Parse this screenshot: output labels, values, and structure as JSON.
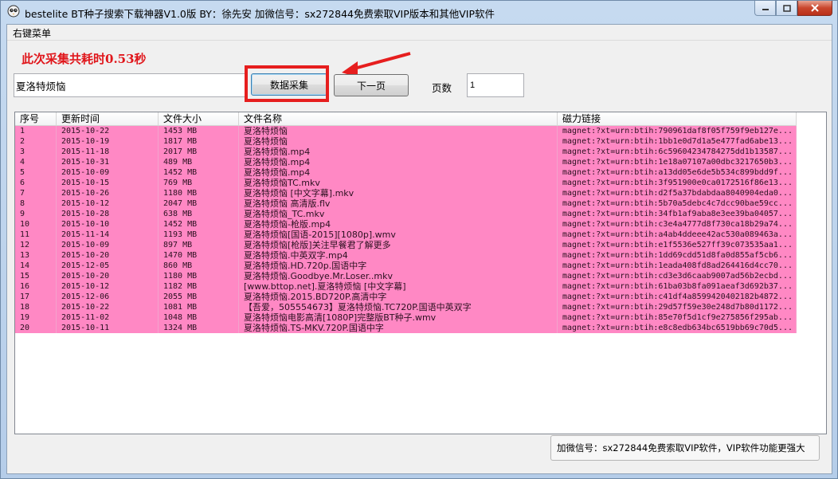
{
  "window": {
    "title": "bestelite BT种子搜索下载神器V1.0版  BY：徐先安   加微信号：sx272844免费索取VIP版本和其他VIP软件"
  },
  "menu": {
    "right_click_menu": "右键菜单"
  },
  "status_text": "此次采集共耗时0.53秒",
  "search": {
    "value": "夏洛特烦恼"
  },
  "buttons": {
    "collect": "数据采集",
    "next_page": "下一页"
  },
  "page": {
    "label": "页数",
    "value": "1"
  },
  "table": {
    "headers": [
      "序号",
      "更新时间",
      "文件大小",
      "文件名称",
      "磁力链接"
    ],
    "rows": [
      [
        "1",
        "2015-10-22",
        "1453 MB",
        "夏洛特烦恼",
        "magnet:?xt=urn:btih:790961daf8f05f759f9eb127e..."
      ],
      [
        "2",
        "2015-10-19",
        "1817 MB",
        "夏洛特烦恼",
        "magnet:?xt=urn:btih:1bb1e0d7d1a5e477fad6abe13..."
      ],
      [
        "3",
        "2015-11-18",
        "2017 MB",
        "夏洛特烦恼.mp4",
        "magnet:?xt=urn:btih:6c59604234784275dd1b13587..."
      ],
      [
        "4",
        "2015-10-31",
        "489 MB",
        "夏洛特烦恼.mp4",
        "magnet:?xt=urn:btih:1e18a07107a00dbc3217650b3..."
      ],
      [
        "5",
        "2015-10-09",
        "1452 MB",
        "夏洛特烦恼.mp4",
        "magnet:?xt=urn:btih:a13dd05e6de5b534c899bdd9f..."
      ],
      [
        "6",
        "2015-10-15",
        "769 MB",
        "夏洛特烦恼TC.mkv",
        "magnet:?xt=urn:btih:3f951900e0ca0172516f86e13..."
      ],
      [
        "7",
        "2015-10-26",
        "1180 MB",
        "夏洛特烦恼 [中文字幕].mkv",
        "magnet:?xt=urn:btih:d2f5a37bdabdaa8040904eda0..."
      ],
      [
        "8",
        "2015-10-12",
        "2047 MB",
        "夏洛特烦恼 高清版.flv",
        "magnet:?xt=urn:btih:5b70a5debc4c7dcc90bae59cc..."
      ],
      [
        "9",
        "2015-10-28",
        "638 MB",
        "夏洛特烦恼_TC.mkv",
        "magnet:?xt=urn:btih:34fb1af9aba8e3ee39ba04057..."
      ],
      [
        "10",
        "2015-10-10",
        "1452 MB",
        "夏洛特烦恼-枪版.mp4",
        "magnet:?xt=urn:btih:c3e4a4777d8f730ca18b29a74..."
      ],
      [
        "11",
        "2015-11-14",
        "1193 MB",
        "夏洛特烦恼[国语-2015][1080p].wmv",
        "magnet:?xt=urn:btih:a4ab4ddeee42ac530a089463a..."
      ],
      [
        "12",
        "2015-10-09",
        "897 MB",
        "夏洛特烦恼[枪版]关注早餐君了解更多",
        "magnet:?xt=urn:btih:e1f5536e527ff39c073535aa1..."
      ],
      [
        "13",
        "2015-10-20",
        "1470 MB",
        "夏洛特烦恼.中英双字.mp4",
        "magnet:?xt=urn:btih:1dd69cdd51d8fa0d855af5cb6..."
      ],
      [
        "14",
        "2015-12-05",
        "860 MB",
        "夏洛特烦恼.HD.720p.国语中字",
        "magnet:?xt=urn:btih:1eada408fd8ad264416d4cc70..."
      ],
      [
        "15",
        "2015-10-20",
        "1180 MB",
        "夏洛特烦恼.Goodbye.Mr.Loser..mkv",
        "magnet:?xt=urn:btih:cd3e3d6caab9007ad56b2ecbd..."
      ],
      [
        "16",
        "2015-10-12",
        "1182 MB",
        "[www.bttop.net].夏洛特烦恼 [中文字幕]",
        "magnet:?xt=urn:btih:61ba03b8fa091aeaf3d692b37..."
      ],
      [
        "17",
        "2015-12-06",
        "2055 MB",
        "夏洛特烦恼.2015.BD720P.高清中字",
        "magnet:?xt=urn:btih:c41df4a8599420402182b4872..."
      ],
      [
        "18",
        "2015-10-22",
        "1081 MB",
        "【吾爱，505554673】夏洛特烦恼.TC720P.国语中英双字",
        "magnet:?xt=urn:btih:29d57f59e30e248d7b80d1172..."
      ],
      [
        "19",
        "2015-11-02",
        "1048 MB",
        "夏洛特烦恼电影高清[1080P]完整版BT种子.wmv",
        "magnet:?xt=urn:btih:85e70f5d1cf9e275856f295ab..."
      ],
      [
        "20",
        "2015-10-11",
        "1324 MB",
        "夏洛特烦恼.TS-MKV.720P.国语中字",
        "magnet:?xt=urn:btih:e8c8edb634bc6519bb69c70d5..."
      ]
    ]
  },
  "footer": {
    "text": "加微信号：sx272844免费索取VIP软件，VIP软件功能更强大"
  },
  "colors": {
    "row_highlight": "#ff88c4",
    "status_red": "#e0161b",
    "annotation_red": "#e61e1e"
  }
}
